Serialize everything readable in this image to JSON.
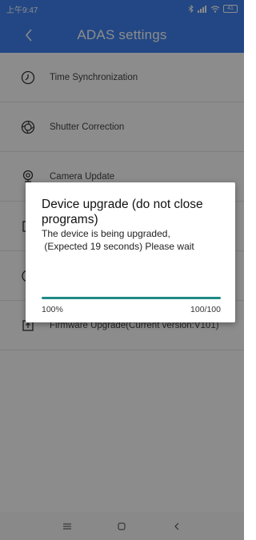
{
  "status_bar": {
    "time": "上午9:47",
    "battery": "41"
  },
  "header": {
    "title": "ADAS settings"
  },
  "menu": {
    "items": [
      {
        "label": "Time Synchronization",
        "icon": "clock-icon"
      },
      {
        "label": "Shutter Correction",
        "icon": "shutter-icon"
      },
      {
        "label": "Camera Update",
        "icon": "camera-icon"
      },
      {
        "label": "",
        "icon": ""
      },
      {
        "label": "",
        "icon": ""
      },
      {
        "label": "Firmware Upgrade(Current version:V101)",
        "icon": "firmware-icon"
      }
    ]
  },
  "dialog": {
    "title": "Device upgrade (do not close programs)",
    "message_line1": "The device is being upgraded,",
    "message_line2": " (Expected 19 seconds) Please wait",
    "progress_percent": "100%",
    "progress_count": "100/100",
    "progress_fraction": 1.0,
    "progress_color": "#1e8a85"
  },
  "colors": {
    "primary": "#3f82f0"
  }
}
